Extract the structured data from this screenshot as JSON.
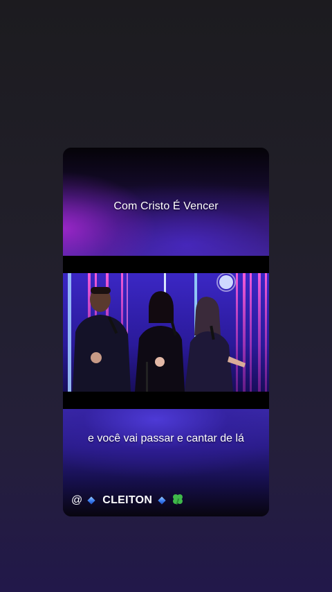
{
  "post": {
    "title": "Com Cristo É Vencer",
    "lyric": "e você vai passar e cantar de lá",
    "handle": {
      "at": "@",
      "name": "CLEITON",
      "icons": [
        "blue-diamond-icon",
        "blue-diamond-icon",
        "four-leaf-clover-icon"
      ]
    }
  },
  "colors": {
    "page_background": "#211f2a",
    "accent_purple": "#a828d2",
    "accent_blue": "#3a22b0",
    "diamond_blue": "#3a7df0",
    "clover_green": "#3fb84a",
    "text": "#ffffff"
  }
}
